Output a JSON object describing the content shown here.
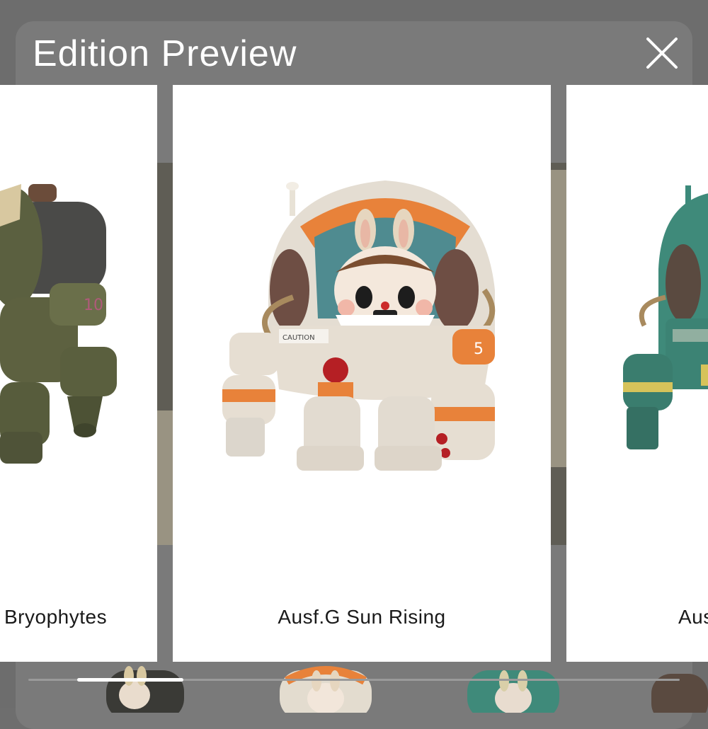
{
  "dialog": {
    "title": "Edition Preview",
    "close_icon": "close-icon"
  },
  "carousel": {
    "cards": [
      {
        "label": "Bryophytes",
        "position": "previous",
        "accent": "#5d6140"
      },
      {
        "label": "Ausf.G Sun Rising",
        "position": "current",
        "accent": "#e6823a"
      },
      {
        "label": "Aus",
        "position": "next",
        "accent": "#3f8a7a"
      }
    ]
  },
  "thumbnail_strip": {
    "items": [
      {
        "icon": "figure-thumbnail-dark"
      },
      {
        "icon": "figure-thumbnail-orange"
      },
      {
        "icon": "figure-thumbnail-teal"
      },
      {
        "icon": "figure-thumbnail-partial"
      }
    ],
    "scroll_progress": 0.09
  }
}
